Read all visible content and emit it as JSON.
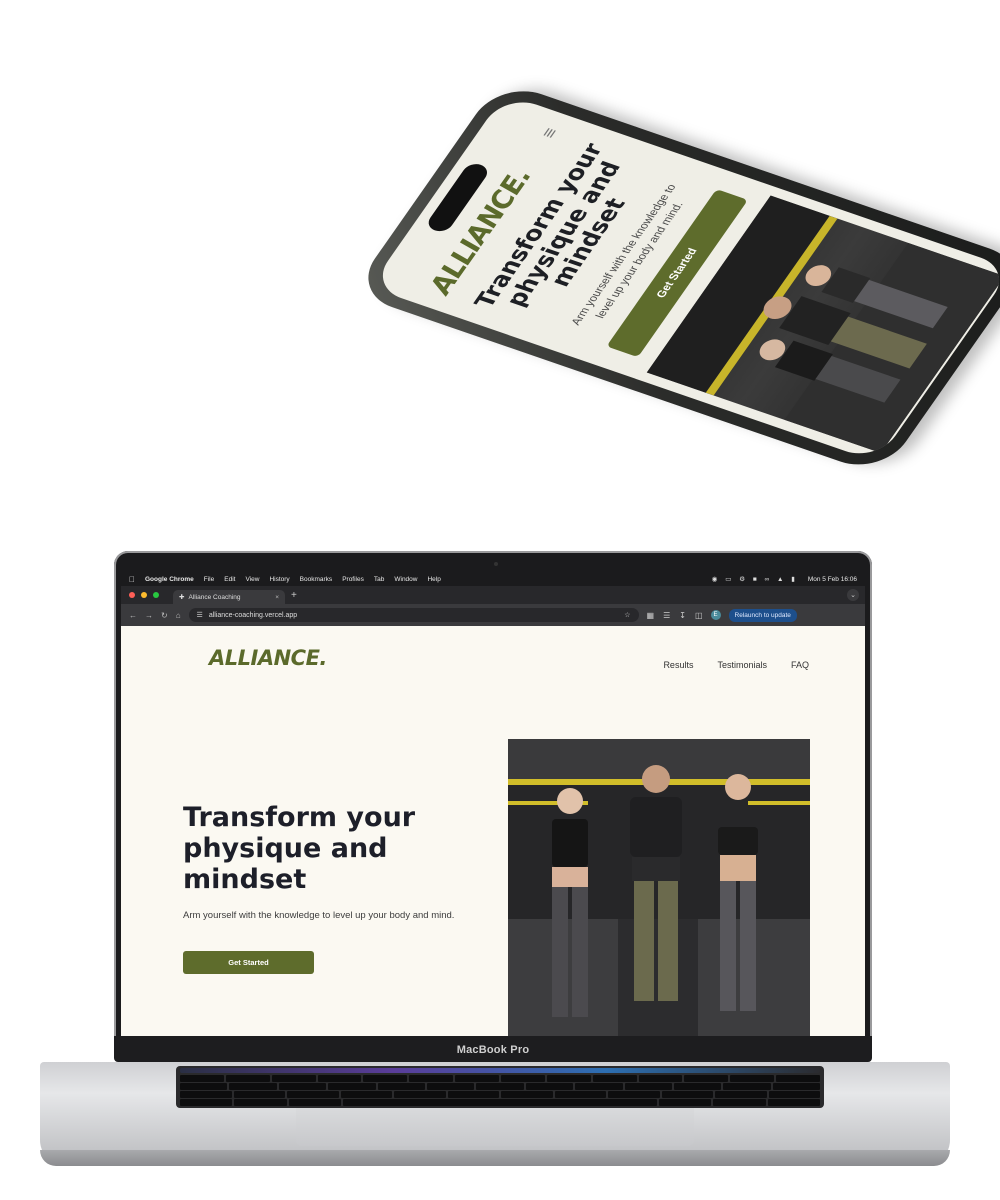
{
  "phone": {
    "logo": "ALLIANCE.",
    "menu_icon": "hamburger-icon",
    "heading": "Transform your physique and mindset",
    "subtitle": "Arm yourself with the knowledge to level up your body and mind.",
    "cta": "Get Started",
    "photo_alt": "Three people flexing in a gym"
  },
  "laptop": {
    "model_label": "MacBook Pro",
    "menubar": {
      "app": "Google Chrome",
      "items": [
        "File",
        "Edit",
        "View",
        "History",
        "Bookmarks",
        "Profiles",
        "Tab",
        "Window",
        "Help"
      ],
      "clock": "Mon 5 Feb  16:06"
    },
    "browser": {
      "tab_title": "Alliance Coaching",
      "url": "alliance-coaching.vercel.app",
      "profile_initial": "E",
      "relaunch_label": "Relaunch to update"
    },
    "site": {
      "logo": "ALLIANCE.",
      "nav": [
        "Results",
        "Testimonials",
        "FAQ"
      ],
      "hero_title": "Transform your physique and mindset",
      "hero_subtitle": "Arm yourself with the knowledge to level up your body and mind.",
      "cta": "Get Started"
    }
  },
  "colors": {
    "brand_olive": "#5e6c2c",
    "page_bg": "#fbf9f2",
    "heading": "#1d1f29"
  }
}
